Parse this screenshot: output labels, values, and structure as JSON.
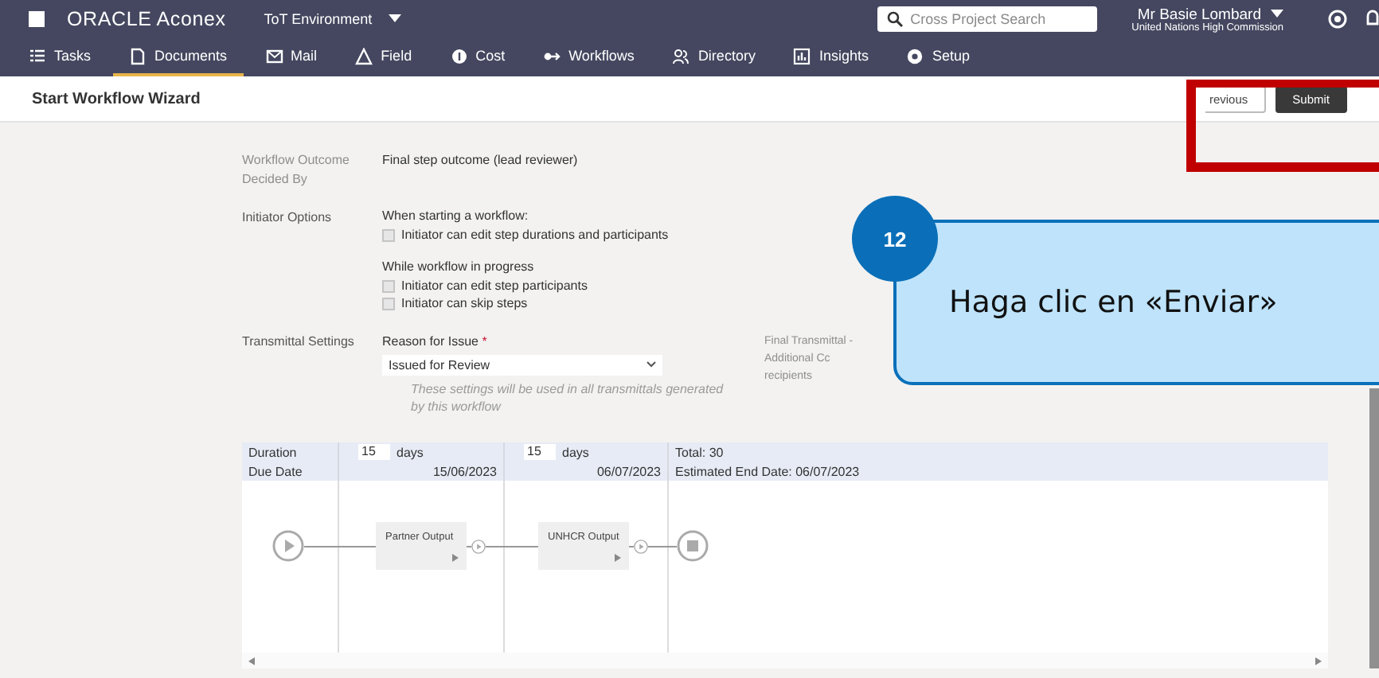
{
  "header": {
    "brand": "ORACLE Aconex",
    "environment": "ToT Environment",
    "search": {
      "placeholder": "Cross Project Search"
    },
    "user": "Mr Basie Lombard",
    "organization": "United Nations High Commission"
  },
  "nav": [
    {
      "label": "Tasks",
      "selected": false
    },
    {
      "label": "Documents",
      "selected": true
    },
    {
      "label": "Mail",
      "selected": false
    },
    {
      "label": "Field",
      "selected": false
    },
    {
      "label": "Cost",
      "selected": false
    },
    {
      "label": "Workflows",
      "selected": false
    },
    {
      "label": "Directory",
      "selected": false
    },
    {
      "label": "Insights",
      "selected": false
    },
    {
      "label": "Setup",
      "selected": false
    }
  ],
  "page": {
    "title": "Start Workflow Wizard",
    "buttons": [
      {
        "label": "revious",
        "kind": "secondary"
      },
      {
        "label": "Submit",
        "kind": "primary"
      }
    ]
  },
  "form": {
    "outcome": {
      "label": "Workflow Outcome Decided By",
      "value": "Final step outcome (lead reviewer)"
    },
    "initiator": {
      "label": "Initiator Options",
      "groups": [
        {
          "heading": "When starting a workflow:",
          "options": [
            {
              "label": "Initiator can edit step durations and participants",
              "checked": false
            }
          ]
        },
        {
          "heading": "While workflow in progress",
          "options": [
            {
              "label": "Initiator can edit step participants",
              "checked": false
            },
            {
              "label": "Initiator can skip steps",
              "checked": false
            }
          ]
        }
      ]
    },
    "transmittal": {
      "label": "Transmittal Settings",
      "reason_label": "Reason for Issue",
      "required_mark": "*",
      "reason_value": "Issued for Review",
      "hint": "These settings will be used in all transmittals generated by this workflow",
      "cc_label": "Final Transmittal - Additional Cc recipients"
    }
  },
  "schedule": {
    "duration_label": "Duration",
    "durations": [
      {
        "value": "15",
        "unit": "days"
      },
      {
        "value": "15",
        "unit": "days"
      }
    ],
    "total": "Total: 30",
    "due_label": "Due Date",
    "due_dates": [
      "15/06/2023",
      "06/07/2023"
    ],
    "end_date": "Estimated End Date: 06/07/2023",
    "steps": [
      {
        "name": "Partner Output"
      },
      {
        "name": "UNHCR Output"
      }
    ]
  },
  "callout": {
    "number": "12",
    "text": "Haga clic en «Enviar»"
  }
}
